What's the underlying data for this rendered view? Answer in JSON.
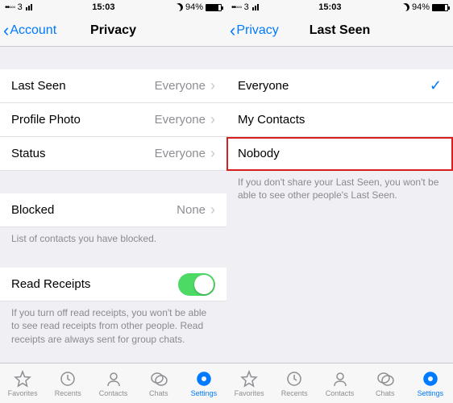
{
  "status": {
    "signal_dots": "••◦◦◦",
    "carrier": "3",
    "time": "15:03",
    "battery_pct": "94%"
  },
  "left": {
    "back_label": "Account",
    "title": "Privacy",
    "rows": {
      "last_seen": {
        "label": "Last Seen",
        "value": "Everyone"
      },
      "profile_photo": {
        "label": "Profile Photo",
        "value": "Everyone"
      },
      "status": {
        "label": "Status",
        "value": "Everyone"
      },
      "blocked": {
        "label": "Blocked",
        "value": "None"
      },
      "blocked_footer": "List of contacts you have blocked.",
      "read_receipts": {
        "label": "Read Receipts"
      },
      "rr_footer": "If you turn off read receipts, you won't be able to see read receipts from other people. Read receipts are always sent for group chats."
    }
  },
  "right": {
    "back_label": "Privacy",
    "title": "Last Seen",
    "options": {
      "everyone": "Everyone",
      "my_contacts": "My Contacts",
      "nobody": "Nobody"
    },
    "footer": "If you don't share your Last Seen, you won't be able to see other people's Last Seen."
  },
  "tabs": {
    "favorites": "Favorites",
    "recents": "Recents",
    "contacts": "Contacts",
    "chats": "Chats",
    "settings": "Settings"
  }
}
